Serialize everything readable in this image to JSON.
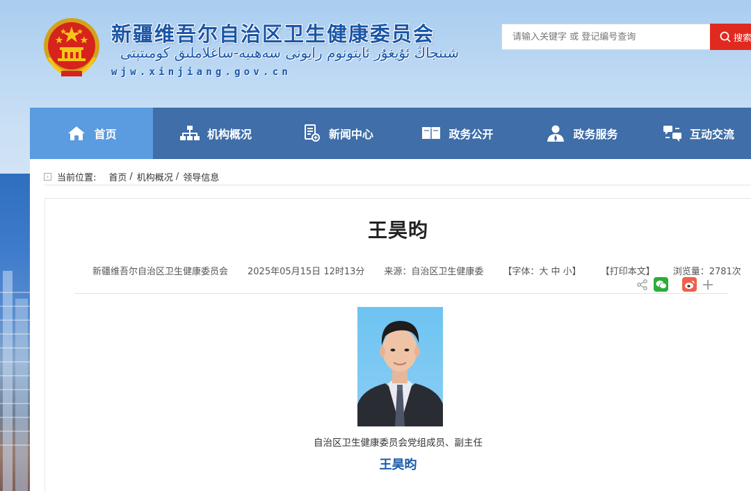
{
  "header": {
    "title_cn": "新疆维吾尔自治区卫生健康委员会",
    "title_ug": "شىنجاڭ ئۇيغۇر ئاپتونوم رايونى سەھىيە-ساغلاملىق كومىتېتى",
    "url": "wjw.xinjiang.gov.cn",
    "search_placeholder": "请输入关键字 或 登记编号查询",
    "search_button": "搜索"
  },
  "nav": {
    "items": [
      {
        "label": "首页",
        "icon": "home-icon"
      },
      {
        "label": "机构概况",
        "icon": "org-chart-icon"
      },
      {
        "label": "新闻中心",
        "icon": "news-icon"
      },
      {
        "label": "政务公开",
        "icon": "book-icon"
      },
      {
        "label": "政务服务",
        "icon": "person-service-icon"
      },
      {
        "label": "互动交流",
        "icon": "exchange-icon"
      }
    ],
    "active_color": "#5b9be0",
    "bar_color": "#3f6ea8"
  },
  "breadcrumb": {
    "prefix": "当前位置:",
    "items": [
      "首页",
      "机构概况",
      "领导信息"
    ],
    "separator": "/"
  },
  "article": {
    "title": "王昊昀",
    "publisher": "新疆维吾尔自治区卫生健康委员会",
    "datetime": "2025年05月15日 12时13分",
    "source": "来源：自治区卫生健康委",
    "font_size": "【字体：大 中 小】",
    "print": "【打印本文】",
    "views": "浏览量：2781次",
    "share_icons": [
      "share-icon",
      "wechat-icon",
      "weibo-icon",
      "plus-icon"
    ],
    "caption": "自治区卫生健康委员会党组成员、副主任",
    "name": "王昊昀"
  }
}
